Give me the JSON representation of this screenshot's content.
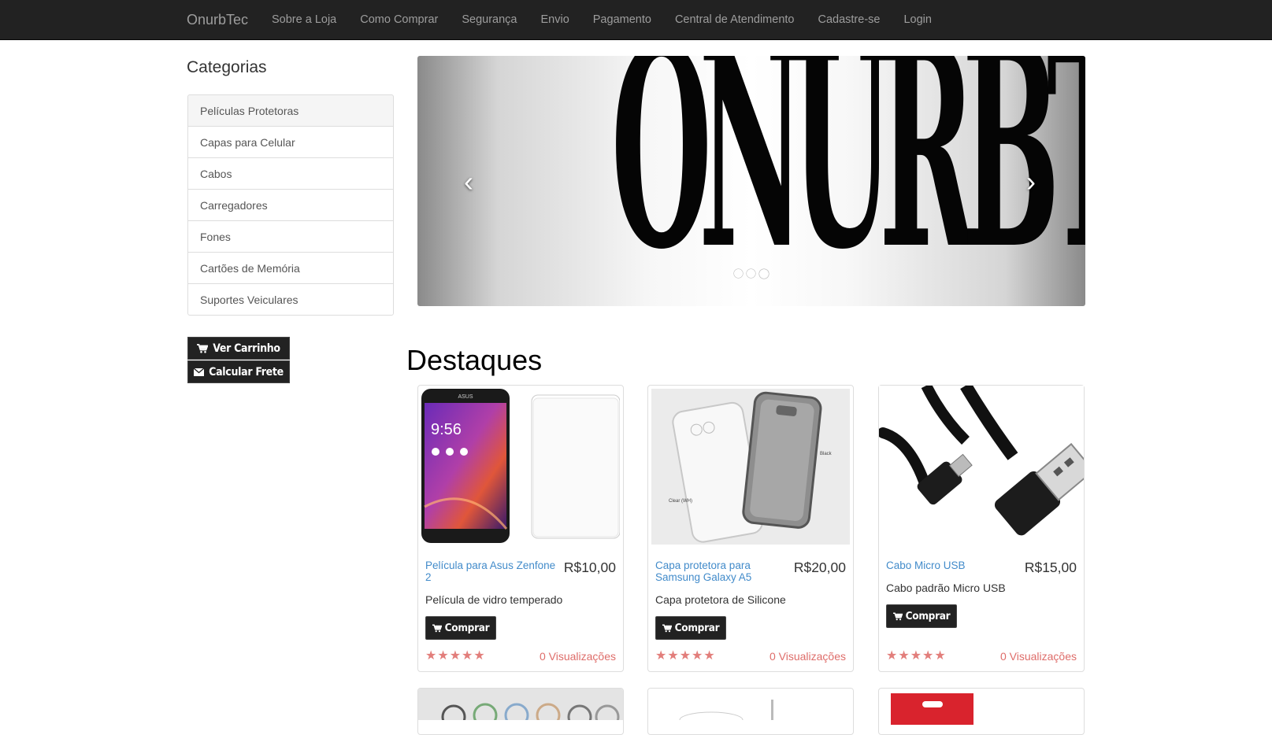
{
  "navbar": {
    "brand": "OnurbTec",
    "items": [
      "Sobre a Loja",
      "Como Comprar",
      "Segurança",
      "Envio",
      "Pagamento",
      "Central de Atendimento",
      "Cadastre-se",
      "Login"
    ]
  },
  "sidebar": {
    "title": "Categorias",
    "categories": [
      "Películas Protetoras",
      "Capas para Celular",
      "Cabos",
      "Carregadores",
      "Fones",
      "Cartões de Memória",
      "Suportes Veiculares"
    ],
    "active_index": 0,
    "cart_button": "Ver Carrinho",
    "shipping_button": "Calcular Frete"
  },
  "carousel": {
    "banner_text": "ONURBTEC",
    "slide_count": 3,
    "active_slide": 2
  },
  "featured": {
    "title": "Destaques",
    "products": [
      {
        "name": "Película para Asus Zenfone 2",
        "price": "R$10,00",
        "description": "Película de vidro temperado",
        "buy_label": "Comprar",
        "rating": "★★★★★",
        "views": "0 Visualizações"
      },
      {
        "name": "Capa protetora para Samsung Galaxy A5",
        "price": "R$20,00",
        "description": "Capa protetora de Silicone",
        "buy_label": "Comprar",
        "rating": "★★★★★",
        "views": "0 Visualizações"
      },
      {
        "name": "Cabo Micro USB",
        "price": "R$15,00",
        "description": "Cabo padrão Micro USB",
        "buy_label": "Comprar",
        "rating": "★★★★★",
        "views": "0 Visualizações"
      }
    ]
  },
  "product_image_labels": {
    "phone_brand": "ASUS",
    "phone_clock": "9:56",
    "case_clear_label": "Clear (WH)",
    "case_black_label": "Black"
  },
  "colors": {
    "navbar_bg": "#222222",
    "link": "#428bca",
    "rating": "#d9534f"
  }
}
